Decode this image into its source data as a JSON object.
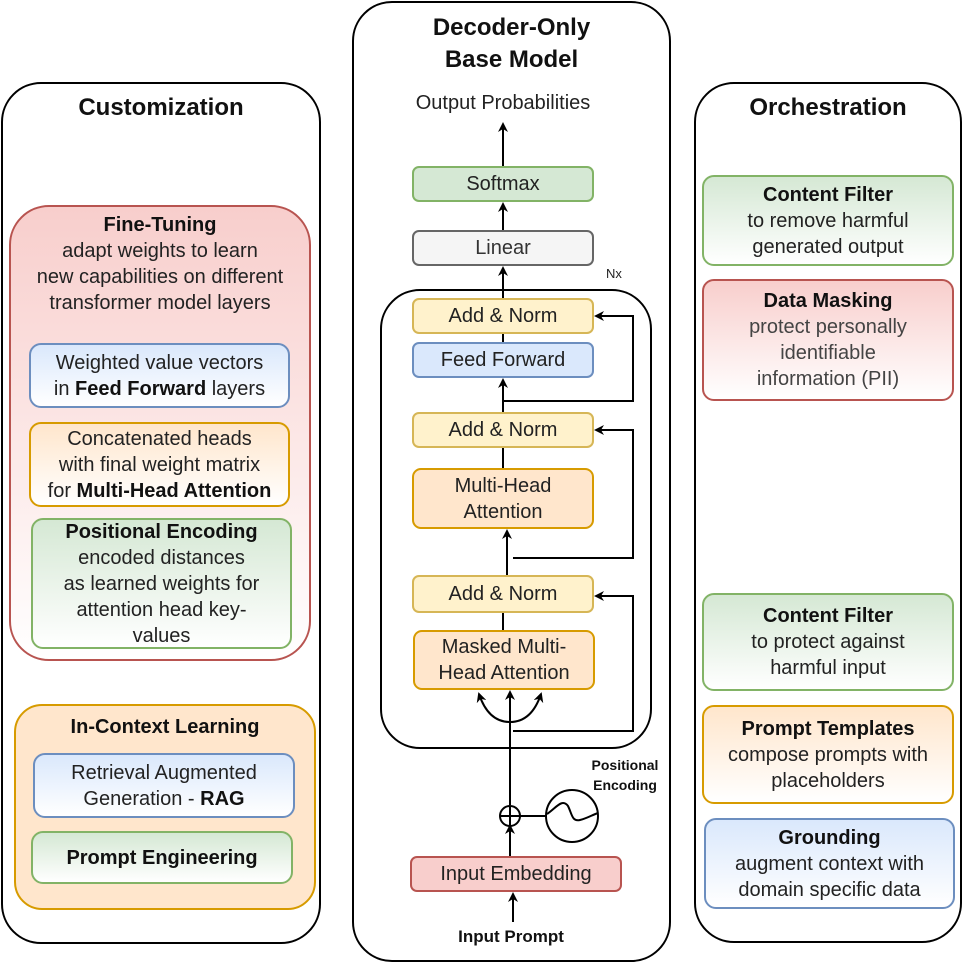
{
  "customization": {
    "title": "Customization",
    "fine_tuning": {
      "title": "Fine-Tuning",
      "lines": [
        "adapt weights to learn",
        "new capabilities on different",
        "transformer model layers"
      ],
      "feed_forward": {
        "line1": "Weighted value vectors",
        "line2_pre": "in ",
        "line2_bold": "Feed Forward",
        "line2_post": " layers"
      },
      "multi_head": {
        "line1": "Concatenated heads",
        "line2": "with final weight matrix",
        "line3_pre": "for ",
        "line3_bold": "Multi-Head Attention"
      },
      "positional": {
        "title": "Positional Encoding",
        "lines": [
          "encoded distances",
          "as learned weights for",
          "attention head key-",
          "values"
        ]
      }
    },
    "in_context": {
      "title": "In-Context Learning",
      "rag": {
        "line1": "Retrieval Augmented",
        "line2_pre": "Generation - ",
        "line2_bold": "RAG"
      },
      "prompt_engineering": "Prompt Engineering"
    }
  },
  "base_model": {
    "title_line1": "Decoder-Only",
    "title_line2": "Base Model",
    "output_label": "Output Probabilities",
    "softmax": "Softmax",
    "linear": "Linear",
    "repeat_label": "Nx",
    "add_norm": "Add & Norm",
    "feed_forward": "Feed Forward",
    "multi_head_line1": "Multi-Head",
    "multi_head_line2": "Attention",
    "masked_line1": "Masked Multi-",
    "masked_line2": "Head Attention",
    "positional_encoding_line1": "Positional",
    "positional_encoding_line2": "Encoding",
    "input_embedding": "Input Embedding",
    "input_prompt": "Input Prompt"
  },
  "orchestration": {
    "title": "Orchestration",
    "content_filter_output": {
      "title": "Content Filter",
      "lines": [
        "to remove harmful",
        "generated output"
      ]
    },
    "data_masking": {
      "title": "Data Masking",
      "lines": [
        "protect personally",
        "identifiable",
        "information (PII)"
      ]
    },
    "content_filter_input": {
      "title": "Content Filter",
      "lines": [
        "to protect against",
        "harmful input"
      ]
    },
    "prompt_templates": {
      "title": "Prompt Templates",
      "lines": [
        "compose prompts with",
        "placeholders"
      ]
    },
    "grounding": {
      "title": "Grounding",
      "lines": [
        "augment context with",
        "domain specific data"
      ]
    }
  }
}
